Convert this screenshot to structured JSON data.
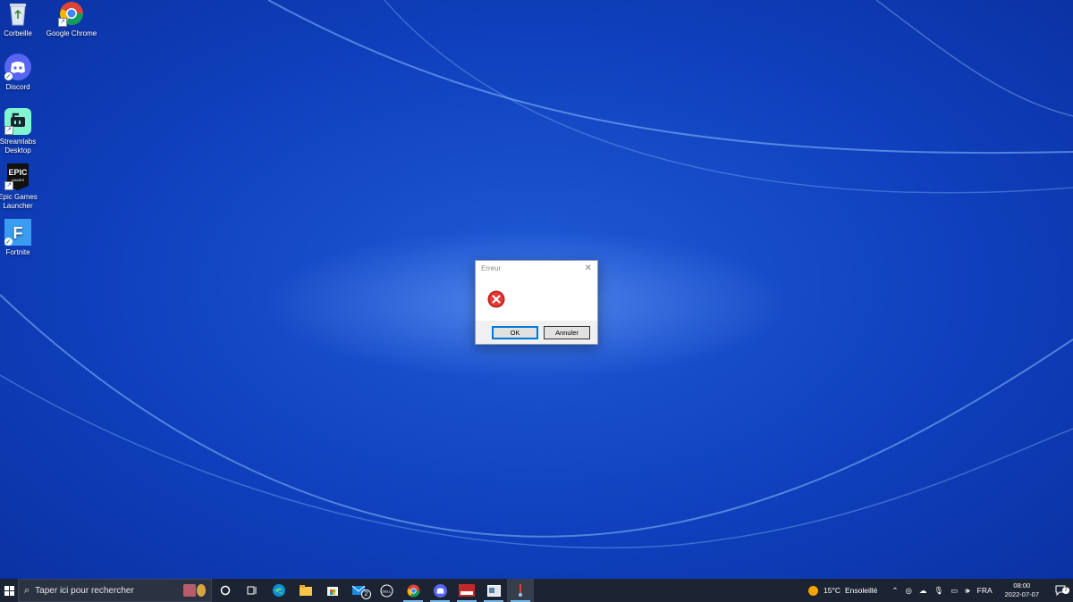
{
  "desktop": {
    "icons": [
      {
        "label": "Corbeille",
        "icon": "recycle-bin-icon"
      },
      {
        "label": "Google Chrome",
        "icon": "chrome-icon"
      },
      {
        "label": "Discord",
        "icon": "discord-icon"
      },
      {
        "label": "Streamlabs Desktop",
        "icon": "streamlabs-icon"
      },
      {
        "label": "Epic Games Launcher",
        "icon": "epic-games-icon",
        "logo_text": "EPIC"
      },
      {
        "label": "Fortnite",
        "icon": "fortnite-icon",
        "logo_text": "F"
      }
    ]
  },
  "dialog": {
    "title": "Erreur",
    "icon": "error-icon",
    "ok_label": "OK",
    "cancel_label": "Annuler"
  },
  "taskbar": {
    "search_placeholder": "Taper ici pour rechercher",
    "apps": [
      "cortana-icon",
      "task-view-icon",
      "edge-icon",
      "file-explorer-icon",
      "microsoft-store-icon",
      "mail-icon",
      "dell-icon",
      "chrome-icon",
      "discord-icon",
      "game-icon",
      "app-window-icon",
      "error-app-icon"
    ],
    "mail_badge": "2",
    "weather": {
      "temp": "15°C",
      "condition": "Ensoleillé"
    },
    "language": "FRA",
    "time": "08:00",
    "date": "2022-07-07",
    "notification_count": "7"
  },
  "colors": {
    "desktop_blue": "#0f3fbc",
    "taskbar": "#1c2433",
    "error_red": "#d32f2f",
    "accent": "#0078d7"
  }
}
